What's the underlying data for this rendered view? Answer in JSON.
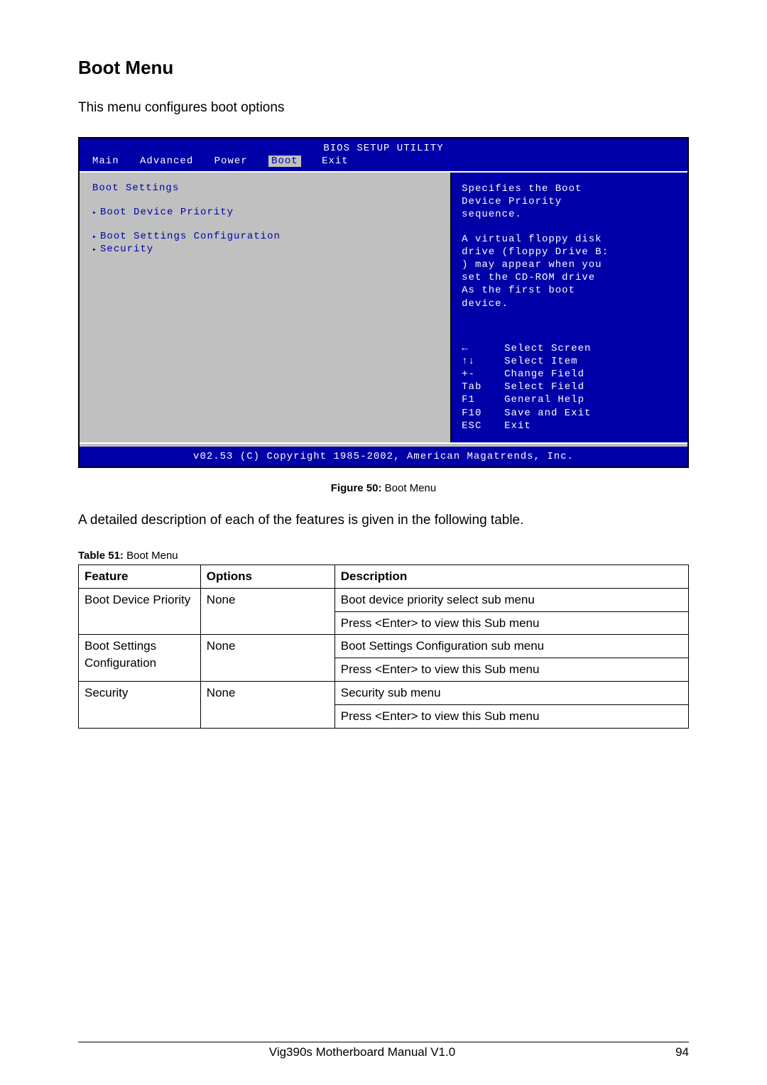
{
  "page": {
    "heading": "Boot Menu",
    "intro": "This menu configures boot options",
    "figure_caption_label": "Figure 50: ",
    "figure_caption_text": "Boot Menu",
    "description_after_figure": "A detailed description of each of the features is given in the following table.",
    "table_caption_label": "Table 51: ",
    "table_caption_text": "Boot Menu"
  },
  "bios": {
    "title": "BIOS SETUP UTILITY",
    "tabs": [
      "Main",
      "Advanced",
      "Power",
      "Boot",
      "Exit"
    ],
    "active_tab": "Boot",
    "left_title": "Boot Settings",
    "menu_items_top": [
      "Boot Device Priority"
    ],
    "menu_items_bottom": [
      "Boot Settings Configuration",
      "Security"
    ],
    "help_top_1": "Specifies the Boot\nDevice Priority\nsequence.",
    "help_top_2": "A virtual floppy disk\ndrive (floppy Drive B:\n) may appear when you\nset the CD-ROM drive\nAs the first boot\ndevice.",
    "keys": [
      {
        "key": "←",
        "action": "Select Screen"
      },
      {
        "key": "↑↓",
        "action": "Select Item"
      },
      {
        "key": "+-",
        "action": "Change Field"
      },
      {
        "key": "Tab",
        "action": "Select Field"
      },
      {
        "key": "F1",
        "action": "General Help"
      },
      {
        "key": "F10",
        "action": "Save and Exit"
      },
      {
        "key": "ESC",
        "action": "Exit"
      }
    ],
    "copyright": "v02.53 (C) Copyright 1985-2002, American Magatrends, Inc."
  },
  "table": {
    "headers": {
      "feature": "Feature",
      "options": "Options",
      "description": "Description"
    },
    "rows": [
      {
        "feature": "Boot Device Priority",
        "options": "None",
        "desc1": "Boot device priority select sub menu",
        "desc2": "Press <Enter> to view this Sub menu"
      },
      {
        "feature": "Boot Settings Configuration",
        "options": "None",
        "desc1": "Boot Settings Configuration sub menu",
        "desc2": "Press <Enter> to view this Sub menu"
      },
      {
        "feature": "Security",
        "options": "None",
        "desc1": "Security sub menu",
        "desc2": "Press <Enter> to view this Sub menu"
      }
    ]
  },
  "footer": {
    "left": "Vig390s Motherboard Manual V1.0",
    "right": "94"
  }
}
